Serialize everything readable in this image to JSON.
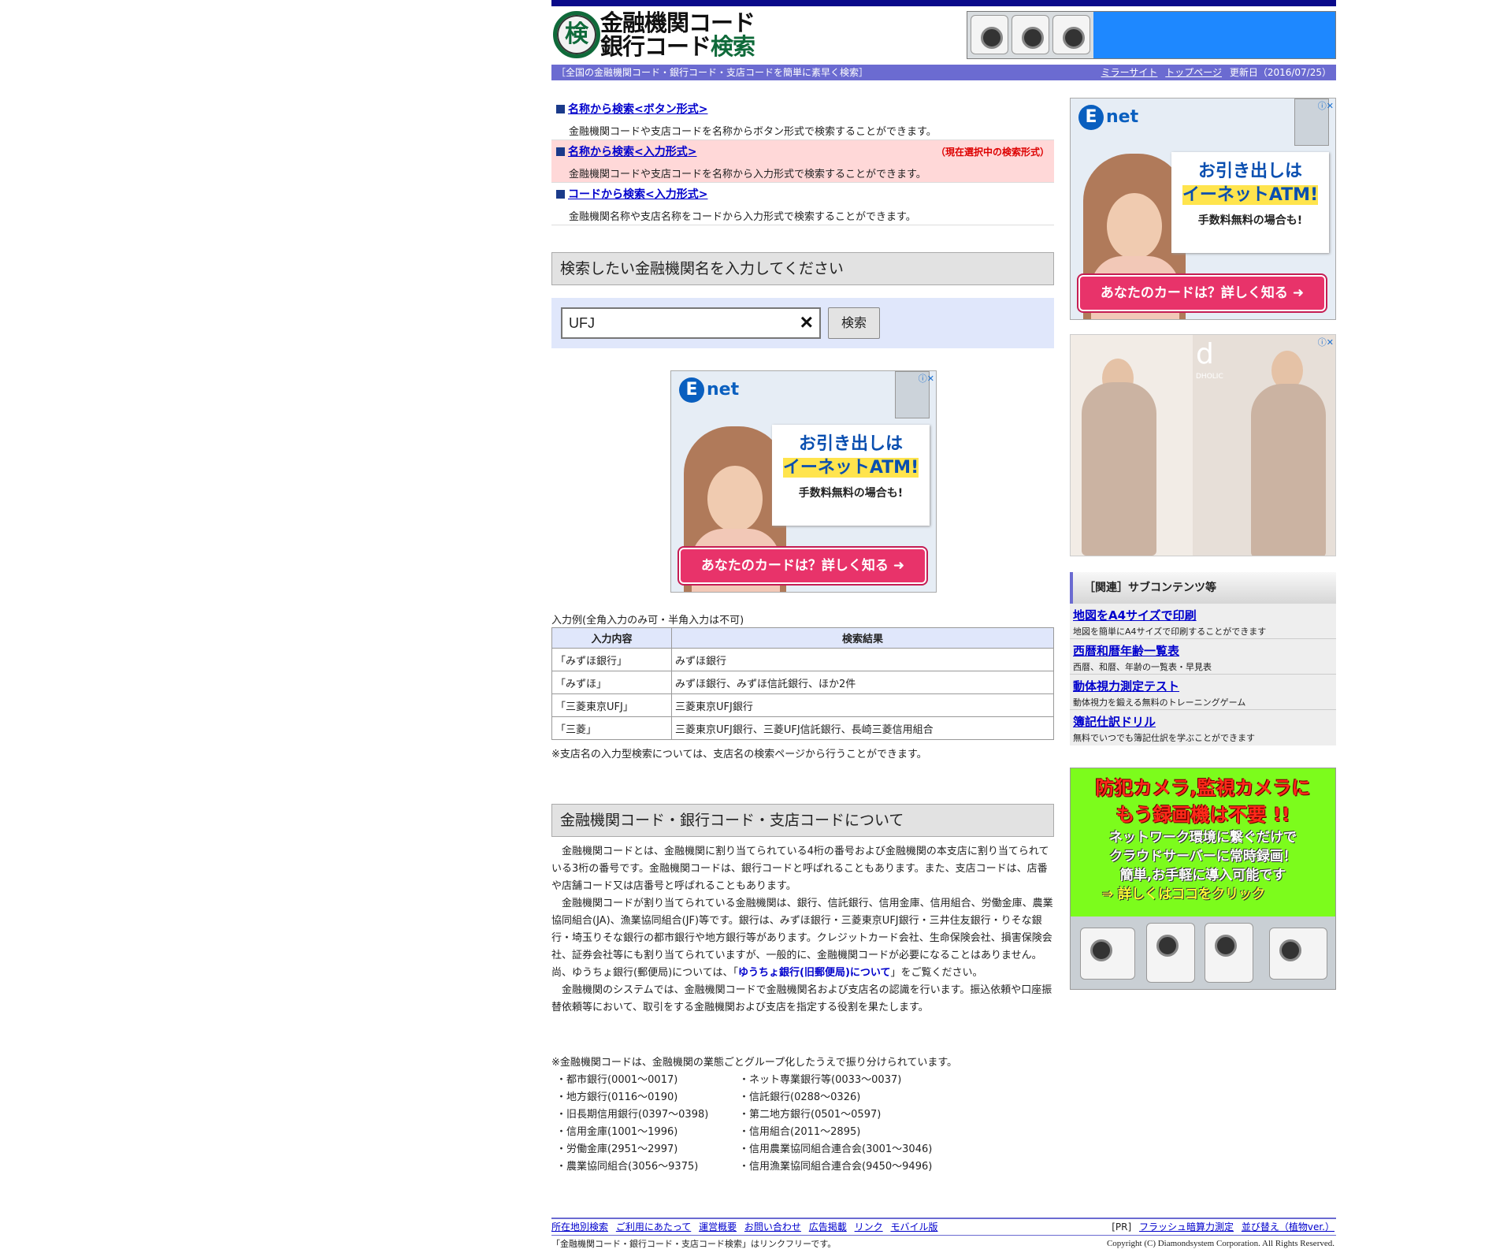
{
  "header": {
    "logo_badge": "検",
    "logo_line1": "金融機関コード",
    "logo_line2a": "銀行コード",
    "logo_line2b": "検索",
    "tagline": "［全国の金融機関コード・銀行コード・支店コードを簡単に素早く検索］",
    "mirror_link": "ミラーサイト",
    "top_link": "トップページ",
    "updated": "更新日（2016/07/25）"
  },
  "menu": [
    {
      "title": "名称から検索<ボタン形式>",
      "desc": "金融機関コードや支店コードを名称からボタン形式で検索することができます。"
    },
    {
      "title": "名称から検索<入力形式>",
      "desc": "金融機関コードや支店コードを名称から入力形式で検索することができます。",
      "current": "（現在選択中の検索形式）"
    },
    {
      "title": "コードから検索<入力形式>",
      "desc": "金融機関名称や支店名称をコードから入力形式で検索することができます。"
    }
  ],
  "search": {
    "heading": "検索したい金融機関名を入力してください",
    "value": "UFJ",
    "clear_icon": "×",
    "button": "検索"
  },
  "ad_enet": {
    "logo": "net",
    "logo_e": "E",
    "line1": "お引き出しは",
    "line2": "イーネットATM!",
    "line3": "手数料無料の場合も!",
    "cta": "あなたのカードは？詳しく知る ➜"
  },
  "examples": {
    "caption": "入力例(全角入力のみ可・半角入力は不可)",
    "headers": [
      "入力内容",
      "検索結果"
    ],
    "rows": [
      [
        "「みずほ銀行」",
        "みずほ銀行"
      ],
      [
        "「みずほ」",
        "みずほ銀行、みずほ信託銀行、ほか2件"
      ],
      [
        "「三菱東京UFJ」",
        "三菱東京UFJ銀行"
      ],
      [
        "「三菱」",
        "三菱東京UFJ銀行、三菱UFJ信託銀行、長崎三菱信用組合"
      ]
    ],
    "note": "※支店名の入力型検索については、支店名の検索ページから行うことができます。"
  },
  "about": {
    "heading": "金融機関コード・銀行コード・支店コードについて",
    "p1": "金融機関コードとは、金融機関に割り当てられている4桁の番号および金融機関の本支店に割り当てられている3桁の番号です。金融機関コードは、銀行コードと呼ばれることもあります。また、支店コードは、店番や店舗コード又は店番号と呼ばれることもあります。",
    "p2a": "金融機関コードが割り当てられている金融機関は、銀行、信託銀行、信用金庫、信用組合、労働金庫、農業協同組合(JA)、漁業協同組合(JF)等です。銀行は、みずほ銀行・三菱東京UFJ銀行・三井住友銀行・りそな銀行・埼玉りそな銀行の都市銀行や地方銀行等があります。クレジットカード会社、生命保険会社、損害保険会社、証券会社等にも割り当てられていますが、一般的に、金融機関コードが必要になることはありません。尚、ゆうちょ銀行(郵便局)については、「",
    "p2link": "ゆうちょ銀行(旧郵便局)について",
    "p2b": "」をご覧ください。",
    "p3": "金融機関のシステムでは、金融機関コードで金融機関名および支店名の認識を行います。振込依頼や口座振替依頼等において、取引をする金融機関および支店を指定する役割を果たします。",
    "note": "※金融機関コードは、金融機関の業態ごとグループ化したうえで振り分けられています。",
    "categories_left": [
      "・都市銀行(0001～0017)",
      "・地方銀行(0116～0190)",
      "・旧長期信用銀行(0397～0398)",
      "・信用金庫(1001～1996)",
      "・労働金庫(2951～2997)",
      "・農業協同組合(3056～9375)"
    ],
    "categories_right": [
      "・ネット専業銀行等(0033～0037)",
      "・信託銀行(0288～0326)",
      "・第二地方銀行(0501～0597)",
      "・信用組合(2011～2895)",
      "・信用農業協同組合連合会(3001～3046)",
      "・信用漁業協同組合連合会(9450～9496)"
    ]
  },
  "sidebar": {
    "dress_ad_label": "DHOLIC",
    "related_heading": "［関連］サブコンテンツ等",
    "related": [
      {
        "title": "地図をA4サイズで印刷",
        "desc": "地図を簡単にA4サイズで印刷することができます"
      },
      {
        "title": "西暦和暦年齢一覧表",
        "desc": "西暦、和暦、年齢の一覧表・早見表"
      },
      {
        "title": "動体視力測定テスト",
        "desc": "動体視力を鍛える無料のトレーニングゲーム"
      },
      {
        "title": "簿記仕訳ドリル",
        "desc": "無料でいつでも簿記仕訳を学ぶことができます"
      }
    ],
    "cam_ad": {
      "h1": "防犯カメラ,監視カメラに",
      "h2": "もう録画機は不要 !!",
      "t1": "ネットワーク環境に繋ぐだけで",
      "t2": "クラウドサーバーに常時録画！",
      "t3": "簡単,お手軽に導入可能です",
      "t4": "⇒ 詳しくはココをクリック"
    }
  },
  "footer": {
    "links": [
      "所在地別検索",
      "ご利用にあたって",
      "運営概要",
      "お問い合わせ",
      "広告掲載",
      "リンク",
      "モバイル版"
    ],
    "pr_label": "[PR]",
    "pr_links": [
      "フラッシュ暗算力測定",
      "並び替え（植物ver.）"
    ],
    "linkfree": "「金融機関コード・銀行コード・支店コード検索」はリンクフリーです。",
    "copyright": "Copyright (C) Diamondsystem Corporation. All Rights Reserved."
  },
  "colors": {
    "accent": "#6b6bd1",
    "topbar": "#0a0a8a",
    "selected": "#ffd8d8",
    "search_bg": "#e0e7fb"
  }
}
